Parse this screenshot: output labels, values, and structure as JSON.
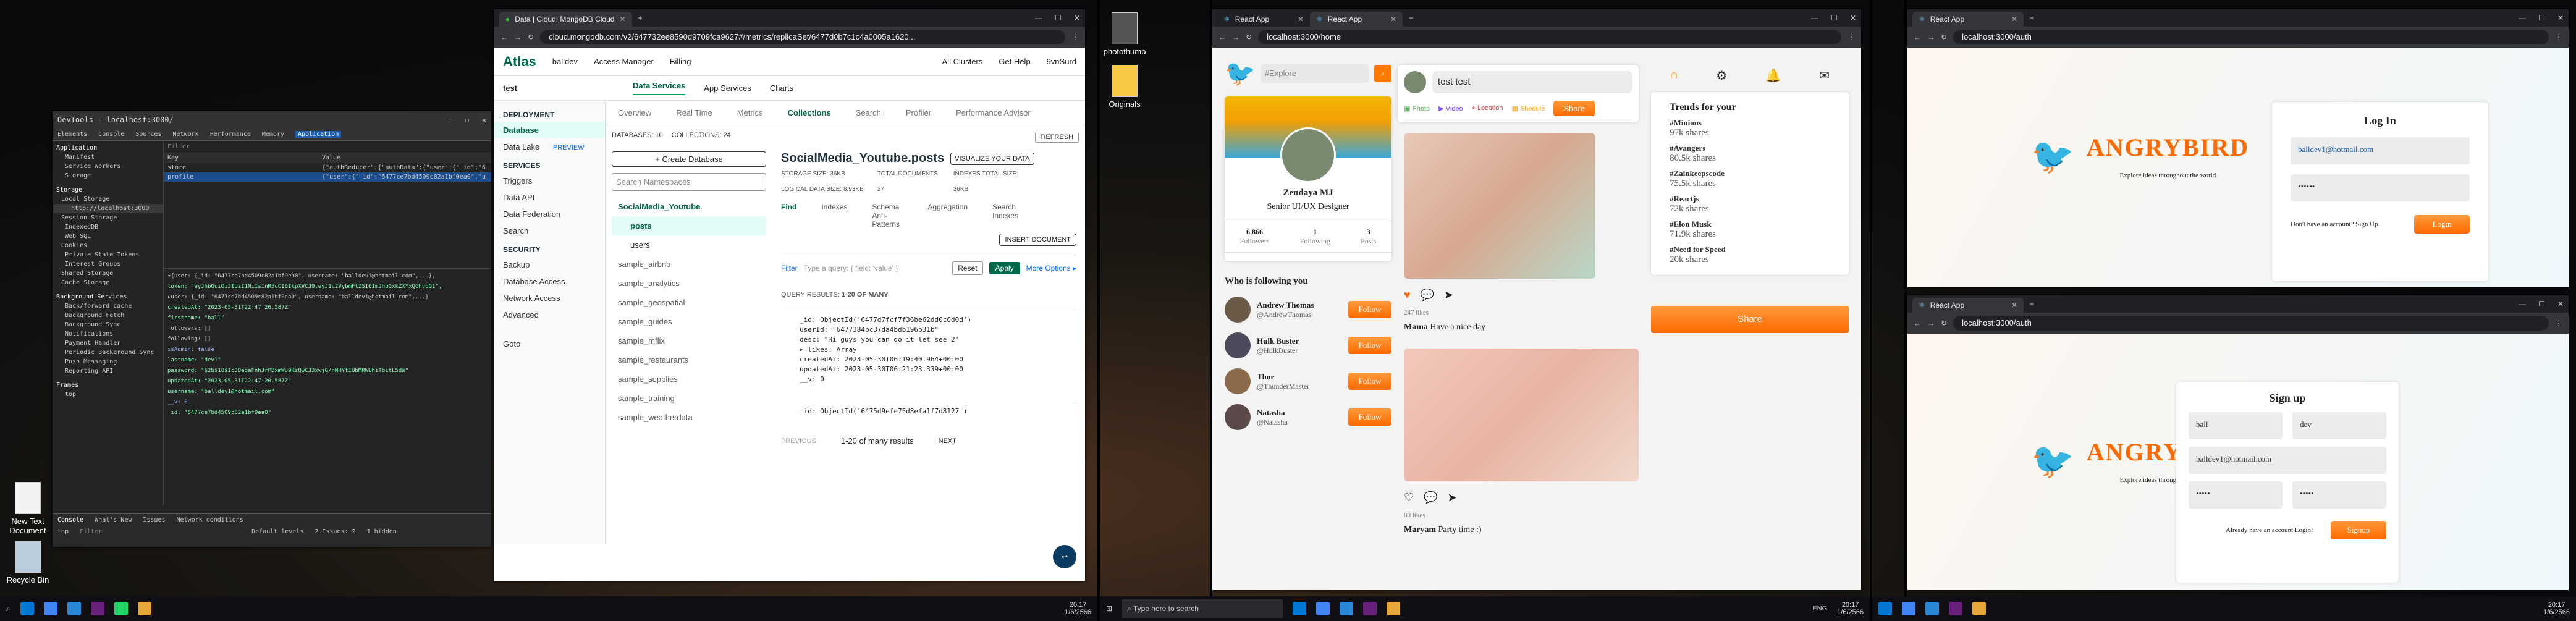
{
  "desktop": {
    "icons": [
      {
        "label": "photothumb"
      },
      {
        "label": "Originals"
      },
      {
        "label": "New Text Document"
      },
      {
        "label": "Recycle Bin"
      }
    ]
  },
  "devtools": {
    "title": "DevTools - localhost:3000/",
    "tabs": [
      "Elements",
      "Console",
      "Sources",
      "Network",
      "Performance",
      "Memory",
      "Application"
    ],
    "filter_placeholder": "Filter",
    "app_tree": {
      "sections": [
        {
          "title": "Application",
          "items": [
            "Manifest",
            "Service Workers",
            "Storage"
          ]
        },
        {
          "title": "Storage",
          "items": [
            "Local Storage",
            "http://localhost:3000",
            "Session Storage",
            "IndexedDB",
            "Web SQL",
            "Cookies",
            "Private State Tokens",
            "Interest Groups",
            "Shared Storage",
            "Cache Storage"
          ]
        },
        {
          "title": "Background Services",
          "items": [
            "Back/forward cache",
            "Background Fetch",
            "Background Sync",
            "Notifications",
            "Payment Handler",
            "Periodic Background Sync",
            "Push Messaging",
            "Reporting API"
          ]
        },
        {
          "title": "Frames",
          "items": [
            "top"
          ]
        }
      ]
    },
    "table": {
      "headers": [
        "Key",
        "Value"
      ],
      "rows": [
        [
          "store",
          "{\"authReducer\":{\"authData\":{\"user\":{\"_id\":\"647..."
        ],
        [
          "profile",
          "{\"user\":{\"_id\":\"6477ce7bd4509c82a1bf0ea0\",\"use..."
        ]
      ]
    },
    "json_lines": [
      "▾{user: {_id: \"6477ce7bd4509c82a1bf9ea0\", username: \"balldev1@hotmail.com\",...},",
      " token: \"eyJhbGciOiJIUzI1NiIsInR5cCI6IkpXVCJ9.eyJ1c2VybmFtZSI6ImJhbGxkZXYxQGhvdG1\",",
      "  ▸user: {_id: \"6477ce7bd4509c82a1bf0ea0\", username: \"balldev1@hotmail.com\",...}",
      "    createdAt: \"2023-05-31T22:47:20.587Z\"",
      "    firstname: \"ball\"",
      "    followers: []",
      "    following: []",
      "    isAdmin: false",
      "    lastname: \"dev1\"",
      "    password: \"$2b$10$Ic3DagaFnhJrPBxmWu9KzQwCJ3xwjG/nNHYtIUbMRWUhiTbitL5dW\"",
      "    updatedAt: \"2023-05-31T22:47:20.587Z\"",
      "    username: \"balldev1@hotmail.com\"",
      "    __v: 0",
      "    _id: \"6477ce7bd4509c82a1bf9ea0\""
    ],
    "console": {
      "tabs": [
        "Console",
        "What's New",
        "Issues",
        "Network conditions"
      ],
      "context": "top",
      "filter": "Filter",
      "levels": "Default levels",
      "issues": "2 Issues: 2",
      "hidden": "1 hidden"
    }
  },
  "atlas": {
    "tab_title": "Data | Cloud: MongoDB Cloud",
    "url": "cloud.mongodb.com/v2/647732ee8590d9709fca9627#/metrics/replicaSet/6477d0b7c1c4a0005a1620...",
    "logo": "Atlas",
    "org": "balldev",
    "nav": [
      "Access Manager",
      "Billing",
      "All Clusters",
      "Get Help",
      "9vnSurd"
    ],
    "project": "test",
    "top_tabs": [
      "Data Services",
      "App Services",
      "Charts"
    ],
    "side": {
      "deployment_h": "DEPLOYMENT",
      "deployment": [
        "Database",
        "Data Lake",
        "PREVIEW"
      ],
      "services_h": "SERVICES",
      "services": [
        "Triggers",
        "Data API",
        "Data Federation",
        "Search"
      ],
      "security_h": "SECURITY",
      "security": [
        "Backup",
        "Database Access",
        "Network Access",
        "Advanced"
      ],
      "goto": "Goto"
    },
    "cluster_tabs": [
      "Overview",
      "Real Time",
      "Metrics",
      "Collections",
      "Search",
      "Profiler",
      "Performance Advisor"
    ],
    "stats": {
      "databases": "DATABASES: 10",
      "collections": "COLLECTIONS: 24",
      "refresh": "REFRESH"
    },
    "create_db": "+ Create Database",
    "search_ns": "Search Namespaces",
    "dbs": [
      "SocialMedia_Youtube",
      "posts",
      "users",
      "sample_airbnb",
      "sample_analytics",
      "sample_geospatial",
      "sample_guides",
      "sample_mflix",
      "sample_restaurants",
      "sample_supplies",
      "sample_training",
      "sample_weatherdata"
    ],
    "coll_title": "SocialMedia_Youtube.posts",
    "visualize": "VISUALIZE YOUR DATA",
    "sizes": {
      "storage": "STORAGE SIZE: 36KB",
      "logical": "LOGICAL DATA SIZE: 8.93KB",
      "total_docs_l": "TOTAL DOCUMENTS:",
      "total_docs": "27",
      "idx_l": "INDEXES TOTAL SIZE:",
      "idx": "36KB"
    },
    "sub_tabs": [
      "Find",
      "Indexes",
      "Schema Anti-Patterns",
      "Aggregation",
      "Search Indexes"
    ],
    "insert": "INSERT DOCUMENT",
    "filter": "Filter",
    "filter_hint": "Type a query: { field: 'value' }",
    "reset": "Reset",
    "apply": "Apply",
    "more": "More Options ▸",
    "query_results_l": "QUERY RESULTS:",
    "query_results": "1-20 OF MANY",
    "doc": [
      "_id: ObjectId('6477d7fcf7f36be62dd0c6d0d')",
      "userId: \"6477384bc37da4bdb196b31b\"",
      "desc: \"Hi guys you can do it let see 2\"",
      "▸ likes: Array",
      "createdAt: 2023-05-30T06:19:40.964+00:00",
      "updatedAt: 2023-05-30T06:21:23.339+00:00",
      "__v: 0"
    ],
    "doc2": "_id: ObjectId('6475d9efe75d8efa1f7d8127')",
    "pager": {
      "prev": "PREVIOUS",
      "label": "1-20 of many results",
      "next": "NEXT"
    }
  },
  "react": {
    "tabs": [
      "React App",
      "React App"
    ],
    "url": "localhost:3000/home",
    "search_placeholder": "#Explore",
    "share_prompt": "test  test",
    "share_actions": [
      "Photo",
      "Video",
      "Location",
      "Shedule"
    ],
    "share_btn": "Share",
    "profile": {
      "name": "Zendaya MJ",
      "role": "Senior UI/UX Designer",
      "followers": "6,866",
      "followers_l": "Followers",
      "following": "1",
      "following_l": "Following",
      "posts": "3",
      "posts_l": "Posts"
    },
    "who_title": "Who is following you",
    "who": [
      {
        "name": "Andrew Thomas",
        "handle": "@AndrewThomas"
      },
      {
        "name": "Hulk Buster",
        "handle": "@HulkBuster"
      },
      {
        "name": "Thor",
        "handle": "@ThunderMaster"
      },
      {
        "name": "Natasha",
        "handle": "@Natasha"
      }
    ],
    "follow": "Follow",
    "posts": [
      {
        "likes": "247 likes",
        "caption_name": "Mama",
        "caption": "Have a nice day"
      },
      {
        "likes": "80 likes",
        "caption_name": "Maryam",
        "caption": "Party time :)"
      }
    ],
    "trends_title": "Trends for your",
    "trends": [
      [
        "#Minions",
        "97k shares"
      ],
      [
        "#Avangers",
        "80.5k shares"
      ],
      [
        "#Zainkeepscode",
        "75.5k shares"
      ],
      [
        "#Reactjs",
        "72k shares"
      ],
      [
        "#Elon Musk",
        "71.9k shares"
      ],
      [
        "#Need for Speed",
        "20k shares"
      ]
    ],
    "share_big": "Share"
  },
  "auth": {
    "tab": "React App",
    "url": "localhost:3000/auth",
    "brand": "ANGRYBIRD",
    "tagline": "Explore ideas throughout the world",
    "login": {
      "title": "Log In",
      "user": "balldev1@hotmail.com",
      "pass": "••••••",
      "prompt": "Don't have an account? Sign Up",
      "btn": "Login"
    },
    "signup": {
      "title": "Sign up",
      "first": "ball",
      "last": "dev",
      "user": "balldev1@hotmail.com",
      "pass": "•••••",
      "confirm": "•••••",
      "prompt": "Already have an account Login!",
      "btn": "Signup"
    }
  },
  "taskbar": {
    "time": "20:17",
    "date": "1/6/2566",
    "search": "Type here to search",
    "lang": "ENG",
    "time2": "20:17",
    "date2": "1/6/2566",
    "time3": "20:17",
    "date3": "1/6/2566"
  }
}
